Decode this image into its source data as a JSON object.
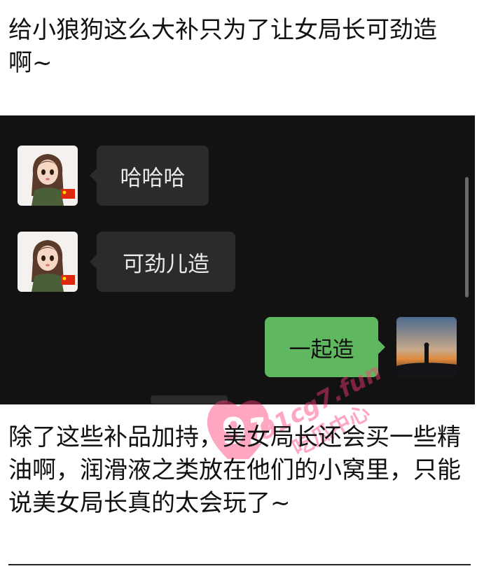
{
  "post": {
    "para_top": "给小狼狗这么大补只为了让女局长可劲造啊~",
    "para_bottom": "除了这些补品加持，美女局长还会买一些精油啊，润滑液之类放在他们的小窝里，只能说美女局长真的太会玩了~"
  },
  "chat": {
    "messages": [
      {
        "sender": "contact",
        "text": "哈哈哈"
      },
      {
        "sender": "contact",
        "text": "可劲儿造"
      },
      {
        "sender": "self",
        "text": "一起造"
      }
    ]
  },
  "watermark": {
    "mark": "91",
    "domain": "91cg7.fun",
    "brand": "吃瓜中心"
  },
  "colors": {
    "chat_bg": "#121212",
    "incoming_bubble": "#2b2b2b",
    "outgoing_bubble": "#5fb860",
    "watermark": "#ff3d77"
  },
  "icons": [
    "girl-avatar-icon",
    "china-flag-icon",
    "sunset-avatar-icon"
  ]
}
